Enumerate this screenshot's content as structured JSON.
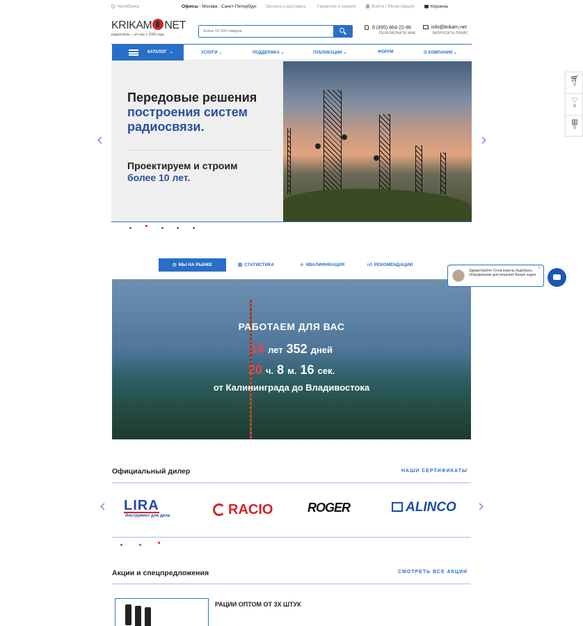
{
  "topbar": {
    "city": "Челябинск",
    "offices_label": "Офисы",
    "offices_sep": "|",
    "moscow": "Москва",
    "slash": "/",
    "spb": "Санкт-Петербург",
    "payment": "Оплата и доставка",
    "warranty": "Гарантия и сервис",
    "login": "Войти / Регистрация",
    "cart": "Корзина"
  },
  "logo": {
    "left": "KRIKAM",
    "right": "NET",
    "tagline": "радиосвязь – это мы    с 2006 года"
  },
  "search": {
    "placeholder": "более 10 000 товаров"
  },
  "phone": {
    "number": "8 (495) 664-22-86",
    "sub": "ПЕРЕЗВОНИТЕ МНЕ"
  },
  "email": {
    "address": "info@krikam.net",
    "sub": "ЗАПРОСИТЬ ПРАЙС"
  },
  "nav": {
    "catalog": "КАТАЛОГ",
    "items": [
      "УСЛУГИ",
      "ПОДДЕРЖКА",
      "ПУБЛИКАЦИИ",
      "ФОРУМ",
      "О КОМПАНИИ"
    ]
  },
  "hero": {
    "title_1": "Передовые решения",
    "title_2": "построения систем",
    "title_3": "радиосвязи.",
    "sub_1": "Проектируем и строим",
    "sub_2": "более 10 лет."
  },
  "sidetools": {
    "cart_count": "0",
    "fav_count": "0",
    "compare_count": "0"
  },
  "tabs": [
    "МЫ НА РЫНКЕ",
    "СТАТИСТИКА",
    "КВАЛИФИКАЦИЯ",
    "РЕКОМЕНДАЦИИ"
  ],
  "counter": {
    "heading": "РАБОТАЕМ ДЛЯ ВАС",
    "years": "16",
    "years_label": "лет",
    "days": "352",
    "days_label": "дней",
    "hours": "20",
    "hours_label": "ч.",
    "minutes": "8",
    "minutes_label": "м.",
    "seconds": "16",
    "seconds_label": "сек.",
    "geo": "от Калининграда до Владивостока"
  },
  "chat": {
    "message": "Здравствуйте! Готов помочь подобрать оборудование для решения Ваших задач.",
    "close": "×"
  },
  "dealer": {
    "title": "Официальный дилер",
    "link": "НАШИ СЕРТИФИКАТЫ",
    "brands": [
      "LIRA",
      "Инструмент для дела",
      "RACIO",
      "ROGER",
      "ALINCO"
    ]
  },
  "promos": {
    "title": "Акции и спецпредложения",
    "link": "СМОТРЕТЬ ВСЕ АКЦИИ",
    "item_title": "РАЦИИ ОПТОМ ОТ 3Х ШТУК"
  },
  "colors": {
    "accent": "#2a6fc7",
    "red": "#d3232a",
    "dark_blue": "#2a4fa0"
  }
}
